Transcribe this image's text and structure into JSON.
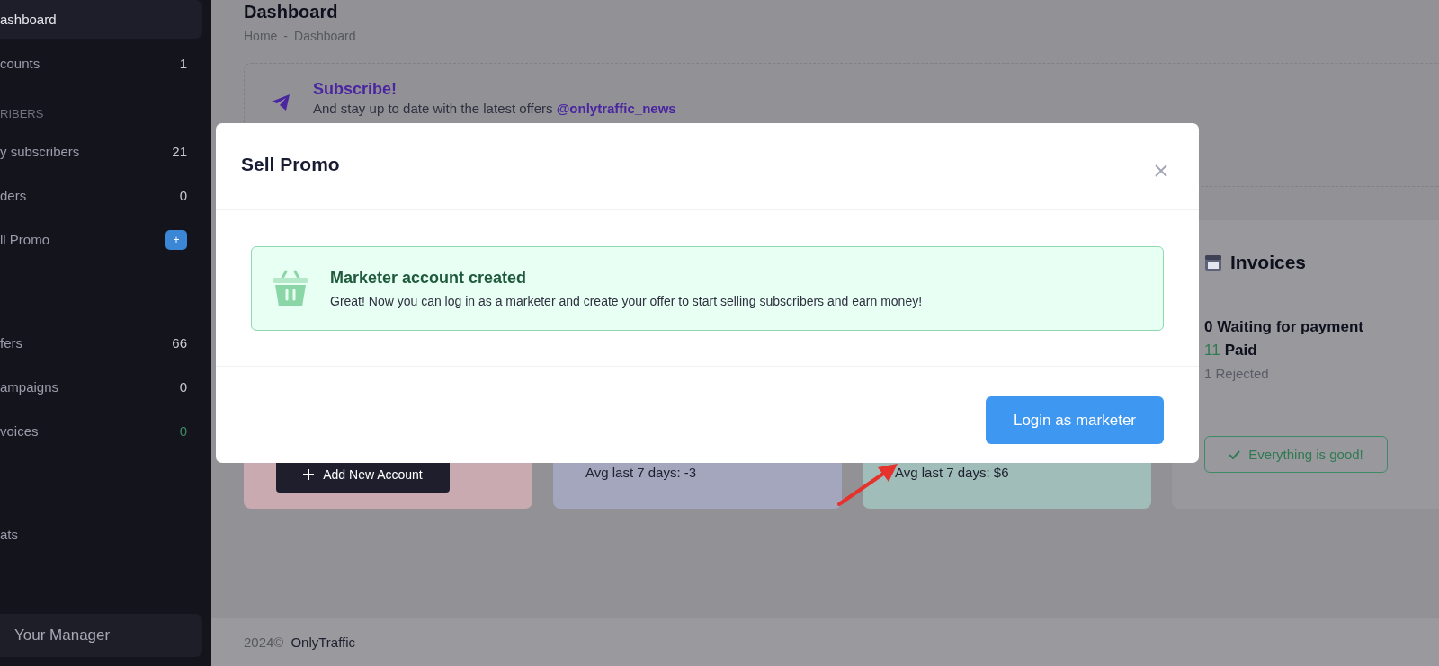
{
  "sidebar": {
    "groups": [
      {
        "items": [
          {
            "label": "ashboard",
            "selected": true
          },
          {
            "label": "counts",
            "count": "1",
            "color": "#c9cad2",
            "selected": false
          }
        ]
      },
      {
        "header": "RIBERS",
        "items": [
          {
            "label": "y subscribers",
            "count": "21",
            "color": "#c9cad2",
            "selected": false
          },
          {
            "label": "ders",
            "count": "0",
            "color": "#c9cad2",
            "selected": false
          },
          {
            "label": "ll Promo",
            "badge": "+",
            "selected": false
          }
        ]
      },
      {
        "items": [
          {
            "label": "fers",
            "count": "66",
            "color": "#c9cad2",
            "selected": false
          },
          {
            "label": "ampaigns",
            "count": "0",
            "color": "#c9cad2",
            "selected": false
          },
          {
            "label": "voices",
            "count": "0",
            "color": "#3f8a66",
            "selected": false
          }
        ]
      },
      {
        "items": [
          {
            "label": "ats",
            "selected": false
          }
        ]
      }
    ],
    "manager_button": "Your Manager"
  },
  "page": {
    "title": "Dashboard",
    "breadcrumb": [
      "Home",
      "Dashboard"
    ],
    "breadcrumb_separator": "-"
  },
  "banner": {
    "title": "Subscribe!",
    "text": "And stay up to date with the latest offers",
    "link": "@onlytraffic_news"
  },
  "cards": [
    {
      "kind": "accounts",
      "color": "#c9aab1",
      "button": "Add New Account"
    },
    {
      "kind": "stat",
      "color": "#a4a6be",
      "footer": "Avg last 7 days: -3"
    },
    {
      "kind": "stat",
      "color": "#a0bdb9",
      "footer": "Avg last 7 days: $6"
    }
  ],
  "invoices": {
    "title": "Invoices",
    "waiting": "0 Waiting for payment",
    "paid_count": "11",
    "paid_label": "Paid",
    "rejected": "1 Rejected",
    "status_button": "Everything is good!"
  },
  "footer": {
    "year": "2024©",
    "brand": "OnlyTraffic"
  },
  "modal": {
    "title": "Sell Promo",
    "alert_title": "Marketer account created",
    "alert_text": "Great! Now you can log in as a marketer and create your offer to start selling subscribers and earn money!",
    "button": "Login as marketer"
  }
}
